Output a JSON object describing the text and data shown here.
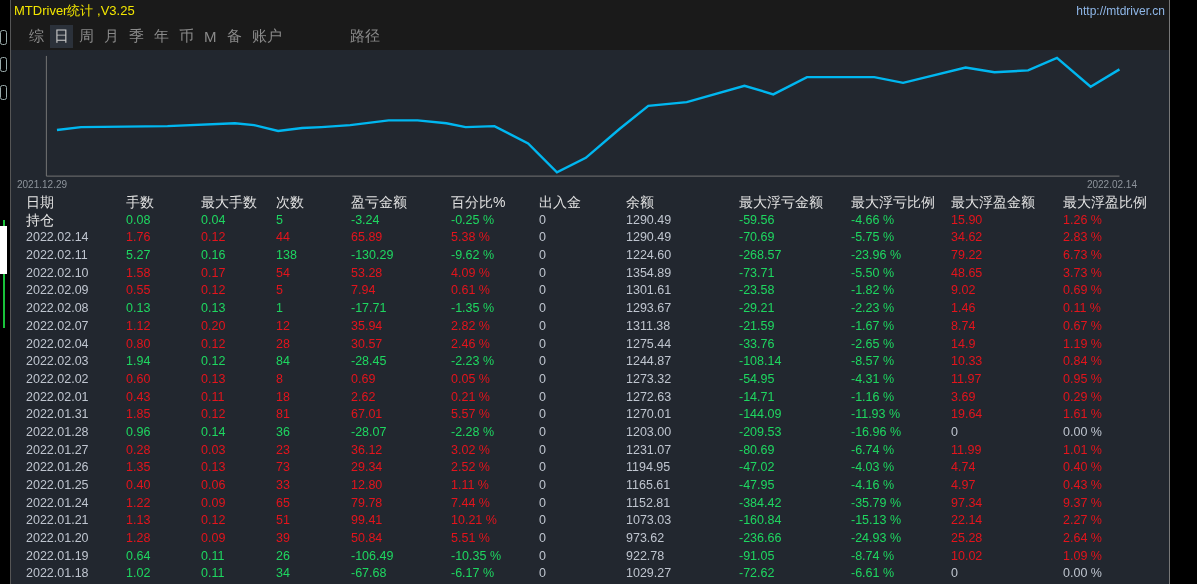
{
  "window": {
    "title": "MTDriver统计 ,V3.25",
    "link": "http://mtdriver.cn"
  },
  "tabs": [
    {
      "label": "综",
      "selected": false
    },
    {
      "label": "日",
      "selected": true
    },
    {
      "label": "周",
      "selected": false
    },
    {
      "label": "月",
      "selected": false
    },
    {
      "label": "季",
      "selected": false
    },
    {
      "label": "年",
      "selected": false
    },
    {
      "label": "币",
      "selected": false
    },
    {
      "label": "M",
      "selected": false
    },
    {
      "label": "备",
      "selected": false
    },
    {
      "label": "账户",
      "selected": false
    }
  ],
  "path_tab": {
    "label": "路径",
    "selected": false
  },
  "chart": {
    "start_label": "2021.12.29",
    "end_label": "2022.02.14"
  },
  "table": {
    "columns": [
      "日期",
      "手数",
      "最大手数",
      "次数",
      "盈亏金额",
      "百分比%",
      "出入金",
      "余额",
      "最大浮亏金额",
      "最大浮亏比例",
      "最大浮盈金额",
      "最大浮盈比例"
    ],
    "rows": [
      {
        "profit": false,
        "float_gain": true,
        "cells": [
          "持仓",
          "0.08",
          "0.04",
          "5",
          "-3.24",
          "-0.25 %",
          "0",
          "1290.49",
          "-59.56",
          "-4.66 %",
          "15.90",
          "1.26 %"
        ]
      },
      {
        "profit": true,
        "float_gain": true,
        "cells": [
          "2022.02.14",
          "1.76",
          "0.12",
          "44",
          "65.89",
          "5.38 %",
          "0",
          "1290.49",
          "-70.69",
          "-5.75 %",
          "34.62",
          "2.83 %"
        ]
      },
      {
        "profit": false,
        "float_gain": true,
        "cells": [
          "2022.02.11",
          "5.27",
          "0.16",
          "138",
          "-130.29",
          "-9.62 %",
          "0",
          "1224.60",
          "-268.57",
          "-23.96 %",
          "79.22",
          "6.73 %"
        ]
      },
      {
        "profit": true,
        "float_gain": true,
        "cells": [
          "2022.02.10",
          "1.58",
          "0.17",
          "54",
          "53.28",
          "4.09 %",
          "0",
          "1354.89",
          "-73.71",
          "-5.50 %",
          "48.65",
          "3.73 %"
        ]
      },
      {
        "profit": true,
        "float_gain": true,
        "cells": [
          "2022.02.09",
          "0.55",
          "0.12",
          "5",
          "7.94",
          "0.61 %",
          "0",
          "1301.61",
          "-23.58",
          "-1.82 %",
          "9.02",
          "0.69 %"
        ]
      },
      {
        "profit": false,
        "float_gain": true,
        "cells": [
          "2022.02.08",
          "0.13",
          "0.13",
          "1",
          "-17.71",
          "-1.35 %",
          "0",
          "1293.67",
          "-29.21",
          "-2.23 %",
          "1.46",
          "0.11 %"
        ]
      },
      {
        "profit": true,
        "float_gain": true,
        "cells": [
          "2022.02.07",
          "1.12",
          "0.20",
          "12",
          "35.94",
          "2.82 %",
          "0",
          "1311.38",
          "-21.59",
          "-1.67 %",
          "8.74",
          "0.67 %"
        ]
      },
      {
        "profit": true,
        "float_gain": true,
        "cells": [
          "2022.02.04",
          "0.80",
          "0.12",
          "28",
          "30.57",
          "2.46 %",
          "0",
          "1275.44",
          "-33.76",
          "-2.65 %",
          "14.9",
          "1.19 %"
        ]
      },
      {
        "profit": false,
        "float_gain": true,
        "cells": [
          "2022.02.03",
          "1.94",
          "0.12",
          "84",
          "-28.45",
          "-2.23 %",
          "0",
          "1244.87",
          "-108.14",
          "-8.57 %",
          "10.33",
          "0.84 %"
        ]
      },
      {
        "profit": true,
        "float_gain": true,
        "cells": [
          "2022.02.02",
          "0.60",
          "0.13",
          "8",
          "0.69",
          "0.05 %",
          "0",
          "1273.32",
          "-54.95",
          "-4.31 %",
          "11.97",
          "0.95 %"
        ]
      },
      {
        "profit": true,
        "float_gain": true,
        "cells": [
          "2022.02.01",
          "0.43",
          "0.11",
          "18",
          "2.62",
          "0.21 %",
          "0",
          "1272.63",
          "-14.71",
          "-1.16 %",
          "3.69",
          "0.29 %"
        ]
      },
      {
        "profit": true,
        "float_gain": true,
        "cells": [
          "2022.01.31",
          "1.85",
          "0.12",
          "81",
          "67.01",
          "5.57 %",
          "0",
          "1270.01",
          "-144.09",
          "-11.93 %",
          "19.64",
          "1.61 %"
        ]
      },
      {
        "profit": false,
        "float_gain": false,
        "cells": [
          "2022.01.28",
          "0.96",
          "0.14",
          "36",
          "-28.07",
          "-2.28 %",
          "0",
          "1203.00",
          "-209.53",
          "-16.96 %",
          "0",
          "0.00 %"
        ]
      },
      {
        "profit": true,
        "float_gain": true,
        "cells": [
          "2022.01.27",
          "0.28",
          "0.03",
          "23",
          "36.12",
          "3.02 %",
          "0",
          "1231.07",
          "-80.69",
          "-6.74 %",
          "11.99",
          "1.01 %"
        ]
      },
      {
        "profit": true,
        "float_gain": true,
        "cells": [
          "2022.01.26",
          "1.35",
          "0.13",
          "73",
          "29.34",
          "2.52 %",
          "0",
          "1194.95",
          "-47.02",
          "-4.03 %",
          "4.74",
          "0.40 %"
        ]
      },
      {
        "profit": true,
        "float_gain": true,
        "cells": [
          "2022.01.25",
          "0.40",
          "0.06",
          "33",
          "12.80",
          "1.11 %",
          "0",
          "1165.61",
          "-47.95",
          "-4.16 %",
          "4.97",
          "0.43 %"
        ]
      },
      {
        "profit": true,
        "float_gain": true,
        "cells": [
          "2022.01.24",
          "1.22",
          "0.09",
          "65",
          "79.78",
          "7.44 %",
          "0",
          "1152.81",
          "-384.42",
          "-35.79 %",
          "97.34",
          "9.37 %"
        ]
      },
      {
        "profit": true,
        "float_gain": true,
        "cells": [
          "2022.01.21",
          "1.13",
          "0.12",
          "51",
          "99.41",
          "10.21 %",
          "0",
          "1073.03",
          "-160.84",
          "-15.13 %",
          "22.14",
          "2.27 %"
        ]
      },
      {
        "profit": true,
        "float_gain": true,
        "cells": [
          "2022.01.20",
          "1.28",
          "0.09",
          "39",
          "50.84",
          "5.51 %",
          "0",
          "973.62",
          "-236.66",
          "-24.93 %",
          "25.28",
          "2.64 %"
        ]
      },
      {
        "profit": false,
        "float_gain": true,
        "cells": [
          "2022.01.19",
          "0.64",
          "0.11",
          "26",
          "-106.49",
          "-10.35 %",
          "0",
          "922.78",
          "-91.05",
          "-8.74 %",
          "10.02",
          "1.09 %"
        ]
      },
      {
        "profit": false,
        "float_gain": false,
        "cells": [
          "2022.01.18",
          "1.02",
          "0.11",
          "34",
          "-67.68",
          "-6.17 %",
          "0",
          "1029.27",
          "-72.62",
          "-6.61 %",
          "0",
          "0.00 %"
        ]
      }
    ]
  }
}
